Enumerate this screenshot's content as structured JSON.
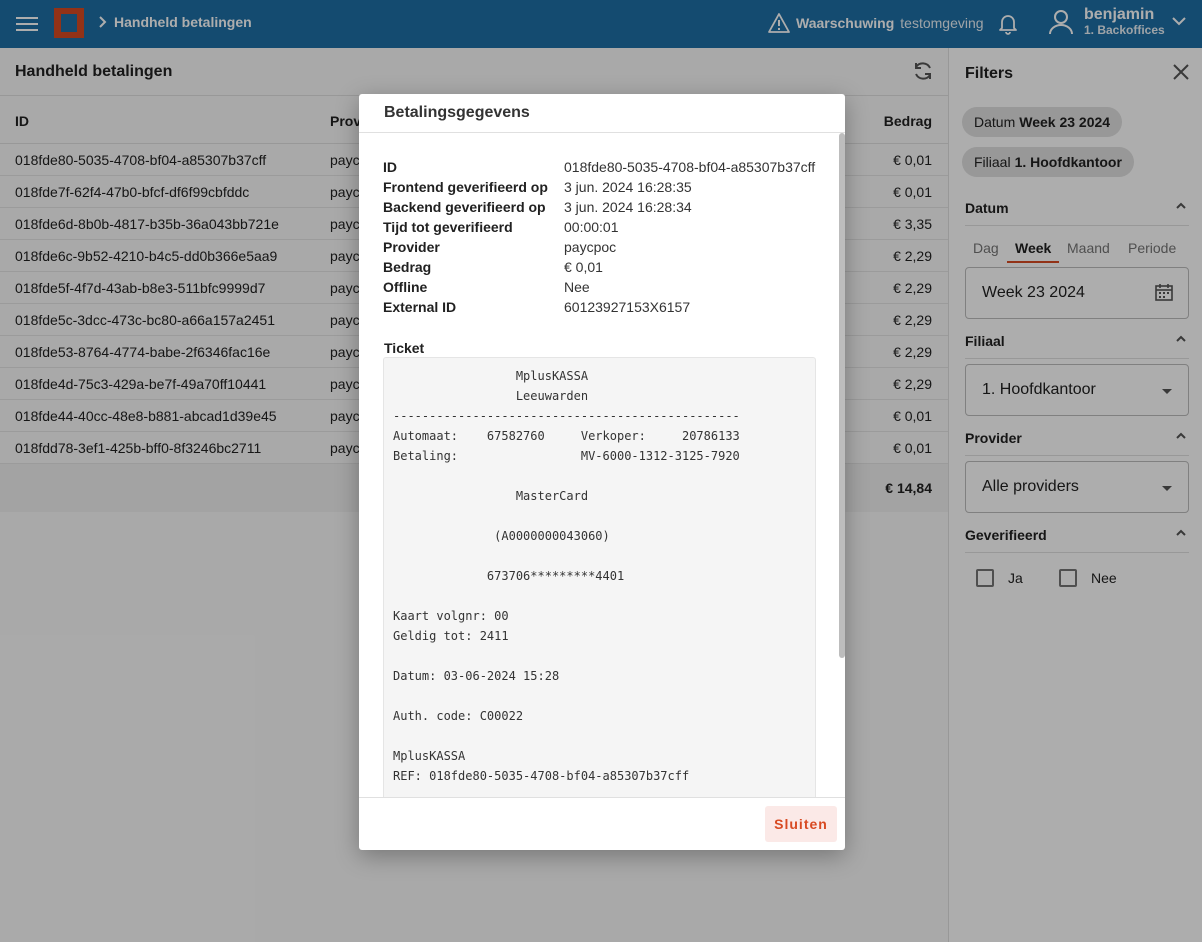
{
  "topbar": {
    "breadcrumb": "Handheld betalingen",
    "warning_strong": "Waarschuwing",
    "warning_text": "testomgeving",
    "user_name": "benjamin",
    "user_role": "1. Backoffices"
  },
  "list": {
    "title": "Handheld betalingen",
    "columns": {
      "id": "ID",
      "provider": "Prov",
      "amount": "Bedrag"
    },
    "rows": [
      {
        "id": "018fde80-5035-4708-bf04-a85307b37cff",
        "provider": "payc",
        "amount": "€ 0,01"
      },
      {
        "id": "018fde7f-62f4-47b0-bfcf-df6f99cbfddc",
        "provider": "payc",
        "amount": "€ 0,01"
      },
      {
        "id": "018fde6d-8b0b-4817-b35b-36a043bb721e",
        "provider": "payc",
        "amount": "€ 3,35"
      },
      {
        "id": "018fde6c-9b52-4210-b4c5-dd0b366e5aa9",
        "provider": "payc",
        "amount": "€ 2,29"
      },
      {
        "id": "018fde5f-4f7d-43ab-b8e3-511bfc9999d7",
        "provider": "payc",
        "amount": "€ 2,29"
      },
      {
        "id": "018fde5c-3dcc-473c-bc80-a66a157a2451",
        "provider": "payc",
        "amount": "€ 2,29"
      },
      {
        "id": "018fde53-8764-4774-babe-2f6346fac16e",
        "provider": "payc",
        "amount": "€ 2,29"
      },
      {
        "id": "018fde4d-75c3-429a-be7f-49a70ff10441",
        "provider": "payc",
        "amount": "€ 2,29"
      },
      {
        "id": "018fde44-40cc-48e8-b881-abcad1d39e45",
        "provider": "payc",
        "amount": "€ 0,01"
      },
      {
        "id": "018fdd78-3ef1-425b-bff0-8f3246bc2711",
        "provider": "payc",
        "amount": "€ 0,01"
      }
    ],
    "total": "€ 14,84"
  },
  "filters": {
    "title": "Filters",
    "chips": [
      {
        "label": "Datum",
        "value": "Week 23 2024"
      },
      {
        "label": "Filiaal",
        "value": "1. Hoofdkantoor"
      }
    ],
    "datum": {
      "heading": "Datum",
      "tabs": [
        "Dag",
        "Week",
        "Maand",
        "Periode"
      ],
      "active_tab": "Week",
      "value": "Week 23 2024"
    },
    "filiaal": {
      "heading": "Filiaal",
      "value": "1. Hoofdkantoor"
    },
    "provider": {
      "heading": "Provider",
      "value": "Alle providers"
    },
    "geverifieerd": {
      "heading": "Geverifieerd",
      "options": [
        "Ja",
        "Nee"
      ]
    }
  },
  "dialog": {
    "title": "Betalingsgegevens",
    "fields": [
      {
        "key": "ID",
        "value": "018fde80-5035-4708-bf04-a85307b37cff"
      },
      {
        "key": "Frontend geverifieerd op",
        "value": "3 jun. 2024 16:28:35"
      },
      {
        "key": "Backend geverifieerd op",
        "value": "3 jun. 2024 16:28:34"
      },
      {
        "key": "Tijd tot geverifieerd",
        "value": "00:00:01"
      },
      {
        "key": "Provider",
        "value": "paycpoc"
      },
      {
        "key": "Bedrag",
        "value": "€ 0,01"
      },
      {
        "key": "Offline",
        "value": "Nee"
      },
      {
        "key": "External ID",
        "value": "60123927153X6157"
      }
    ],
    "ticket_label": "Ticket",
    "ticket_text": "                 MplusKASSA\n                 Leeuwarden\n------------------------------------------------\nAutomaat:    67582760     Verkoper:     20786133\nBetaling:                 MV-6000-1312-3125-7920\n\n                 MasterCard\n\n              (A0000000043060)\n\n             673706*********4401\n\nKaart volgnr: 00\nGeldig tot: 2411\n\nDatum: 03-06-2024 15:28\n\nAuth. code: C00022\n\nMplusKASSA\nREF: 018fde80-5035-4708-bf04-a85307b37cff",
    "close_label": "Sluiten"
  }
}
